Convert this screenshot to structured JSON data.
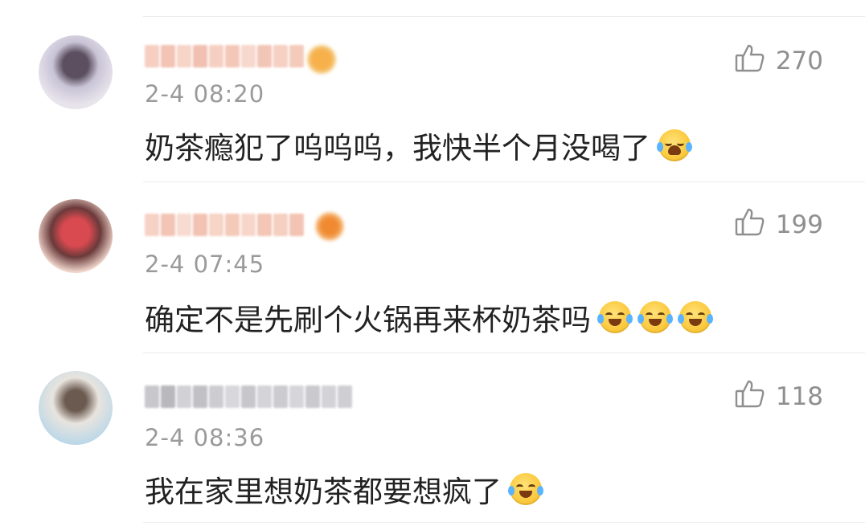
{
  "comments": [
    {
      "time": "2-4 08:20",
      "text": "奶茶瘾犯了呜呜呜，我快半个月没喝了",
      "likes": "270",
      "emojis": [
        "sob-emoji"
      ],
      "avatar_colors": [
        "#c9c4d6",
        "#5c5060",
        "#e8e4ec"
      ],
      "badge_color": "#f0a040"
    },
    {
      "time": "2-4 07:45",
      "text": "确定不是先刷个火锅再来杯奶茶吗",
      "likes": "199",
      "emojis": [
        "laugh-cry-emoji",
        "laugh-cry-emoji",
        "laugh-cry-emoji"
      ],
      "avatar_colors": [
        "#d94a50",
        "#6a3a3a",
        "#f0d6cc"
      ],
      "badge_color": "#f08a30"
    },
    {
      "time": "2-4 08:36",
      "text": "我在家里想奶茶都要想疯了",
      "likes": "118",
      "emojis": [
        "laugh-cry-emoji"
      ],
      "avatar_colors": [
        "#e8e4de",
        "#6b5a50",
        "#bcd8e8"
      ],
      "badge_color": null
    }
  ],
  "colors": {
    "text": "#222222",
    "meta": "#9a9a9a",
    "like": "#8f8f8f",
    "divider": "#ececec"
  }
}
